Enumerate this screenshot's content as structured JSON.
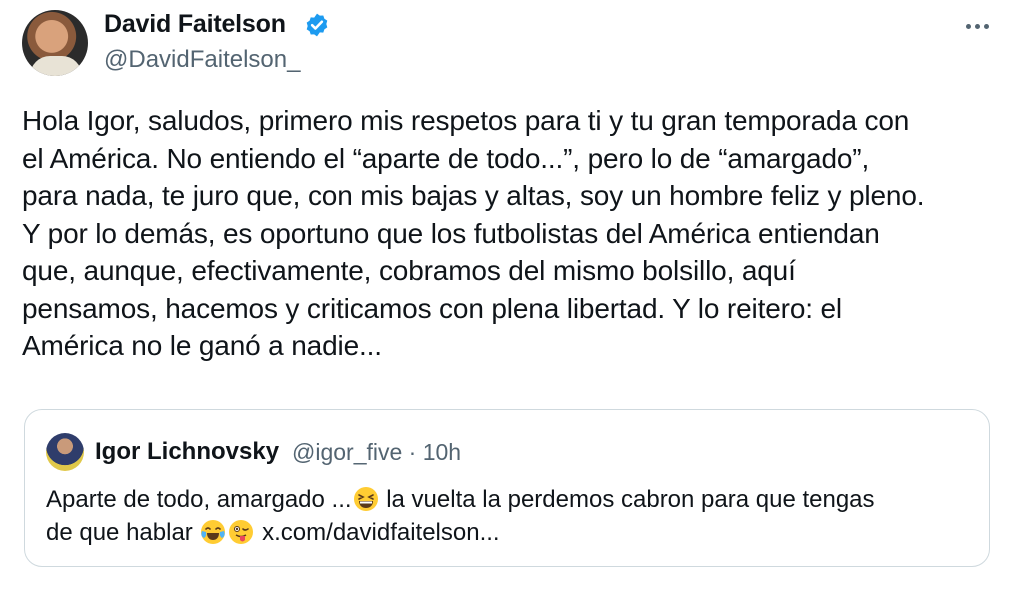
{
  "author": {
    "name": "David Faitelson",
    "handle": "@DavidFaitelson_"
  },
  "tweet": {
    "lines": [
      "Hola Igor, saludos, primero mis respetos para ti y tu gran temporada con",
      "el América. No entiendo el “aparte de todo...”, pero lo de “amargado”,",
      "para nada, te juro que, con mis bajas y altas, soy un hombre feliz y pleno.",
      "Y por lo demás, es oportuno que los futbolistas del América entiendan",
      "que, aunque, efectivamente, cobramos del mismo bolsillo, aquí",
      "pensamos, hacemos y criticamos con plena libertad. Y lo reitero: el",
      "América no le ganó a nadie..."
    ]
  },
  "quoted": {
    "name": "Igor Lichnovsky",
    "handle_time": "@igor_five · 10h",
    "line1_a": "Aparte de todo, amargado ...",
    "line1_b": " la vuelta la perdemos cabron para que tengas",
    "line2_a": "de que hablar ",
    "line2_b": " x.com/davidfaitelson..."
  },
  "icons": {
    "verified": "verified-badge-icon",
    "more": "more-options-icon",
    "emoji1": "grinning-squinting-face-emoji",
    "emoji2": "face-with-tears-of-joy-emoji",
    "emoji3": "winking-face-with-tongue-emoji"
  },
  "colors": {
    "verified_blue": "#1d9bf0",
    "secondary_text": "#536471",
    "border": "#cfd9de"
  }
}
